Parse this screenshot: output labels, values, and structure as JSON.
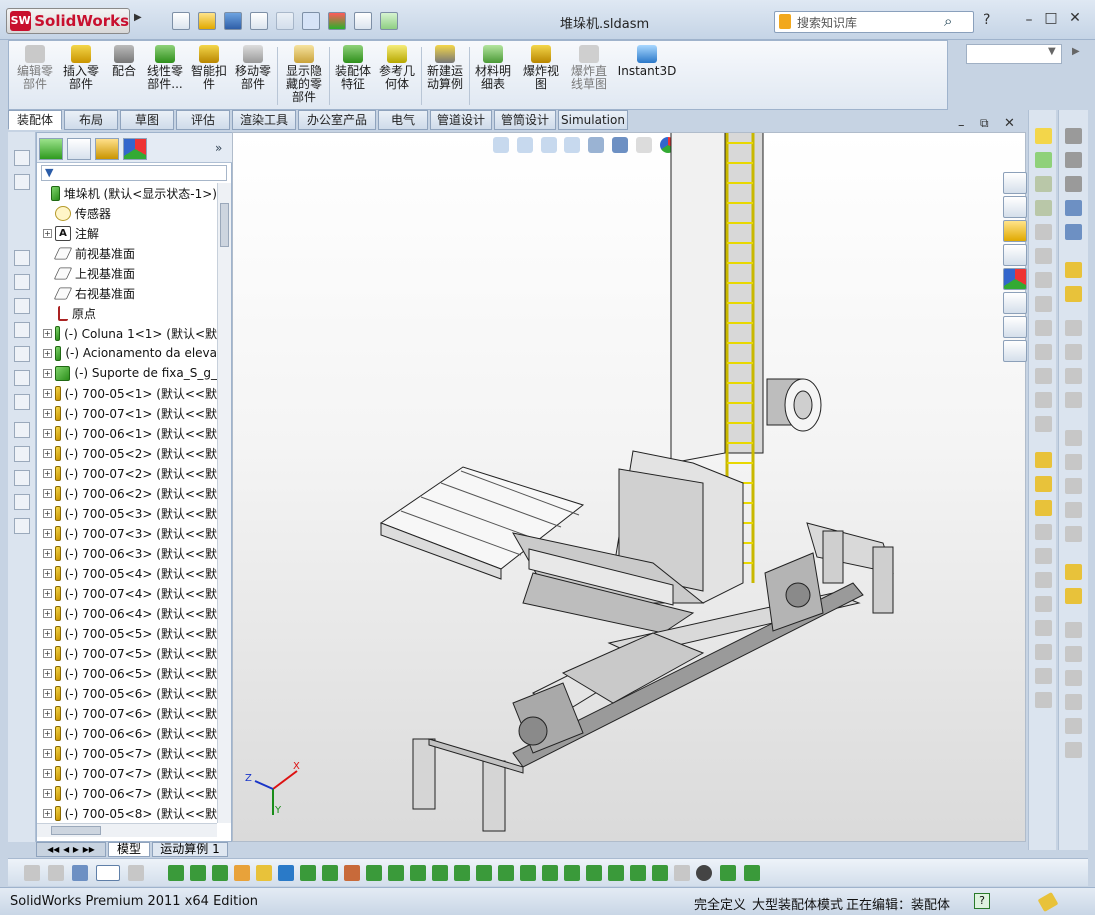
{
  "app": {
    "logo_text": "SolidWorks",
    "document_title": "堆垛机.sldasm"
  },
  "search": {
    "placeholder": "搜索知识库"
  },
  "command_manager": [
    {
      "label": "编辑零\n部件",
      "dim": true
    },
    {
      "label": "插入零\n部件"
    },
    {
      "label": "配合"
    },
    {
      "label": "线性零\n部件..."
    },
    {
      "label": "智能扣\n件"
    },
    {
      "label": "移动零\n部件"
    },
    {
      "label": "显示隐\n藏的零\n部件"
    },
    {
      "label": "装配体\n特征"
    },
    {
      "label": "参考几\n何体"
    },
    {
      "label": "新建运\n动算例"
    },
    {
      "label": "材料明\n细表"
    },
    {
      "label": "爆炸视\n图"
    },
    {
      "label": "爆炸直\n线草图",
      "dim": true
    },
    {
      "label": "Instant3D"
    }
  ],
  "tabs": [
    "装配体",
    "布局",
    "草图",
    "评估",
    "渲染工具",
    "办公室产品",
    "电气",
    "管道设计",
    "管筒设计",
    "Simulation"
  ],
  "tree": [
    {
      "exp": "none",
      "icon": "asm",
      "text": "堆垛机  (默认<显示状态-1>)",
      "indent": 0
    },
    {
      "exp": "none",
      "icon": "sensor",
      "text": "传感器",
      "indent": 1
    },
    {
      "exp": "+",
      "icon": "note",
      "text": "注解",
      "indent": 1
    },
    {
      "exp": "none",
      "icon": "plane",
      "text": "前视基准面",
      "indent": 1
    },
    {
      "exp": "none",
      "icon": "plane",
      "text": "上视基准面",
      "indent": 1
    },
    {
      "exp": "none",
      "icon": "plane",
      "text": "右视基准面",
      "indent": 1
    },
    {
      "exp": "none",
      "icon": "origin",
      "text": "原点",
      "indent": 1
    },
    {
      "exp": "+",
      "icon": "asm",
      "text": "(-) Coluna 1<1> (默认<默",
      "indent": 1
    },
    {
      "exp": "+",
      "icon": "asm",
      "text": "(-) Acionamento da eleva",
      "indent": 1
    },
    {
      "exp": "+",
      "icon": "asm",
      "text": "(-) Suporte de fixa_S_g_",
      "indent": 1
    },
    {
      "exp": "+",
      "icon": "part",
      "text": "(-) 700-05<1> (默认<<默",
      "indent": 1
    },
    {
      "exp": "+",
      "icon": "part",
      "text": "(-) 700-07<1> (默认<<默",
      "indent": 1
    },
    {
      "exp": "+",
      "icon": "part",
      "text": "(-) 700-06<1> (默认<<默",
      "indent": 1
    },
    {
      "exp": "+",
      "icon": "part",
      "text": "(-) 700-05<2> (默认<<默",
      "indent": 1
    },
    {
      "exp": "+",
      "icon": "part",
      "text": "(-) 700-07<2> (默认<<默",
      "indent": 1
    },
    {
      "exp": "+",
      "icon": "part",
      "text": "(-) 700-06<2> (默认<<默",
      "indent": 1
    },
    {
      "exp": "+",
      "icon": "part",
      "text": "(-) 700-05<3> (默认<<默",
      "indent": 1
    },
    {
      "exp": "+",
      "icon": "part",
      "text": "(-) 700-07<3> (默认<<默",
      "indent": 1
    },
    {
      "exp": "+",
      "icon": "part",
      "text": "(-) 700-06<3> (默认<<默",
      "indent": 1
    },
    {
      "exp": "+",
      "icon": "part",
      "text": "(-) 700-05<4> (默认<<默",
      "indent": 1
    },
    {
      "exp": "+",
      "icon": "part",
      "text": "(-) 700-07<4> (默认<<默",
      "indent": 1
    },
    {
      "exp": "+",
      "icon": "part",
      "text": "(-) 700-06<4> (默认<<默",
      "indent": 1
    },
    {
      "exp": "+",
      "icon": "part",
      "text": "(-) 700-05<5> (默认<<默",
      "indent": 1
    },
    {
      "exp": "+",
      "icon": "part",
      "text": "(-) 700-07<5> (默认<<默",
      "indent": 1
    },
    {
      "exp": "+",
      "icon": "part",
      "text": "(-) 700-06<5> (默认<<默",
      "indent": 1
    },
    {
      "exp": "+",
      "icon": "part",
      "text": "(-) 700-05<6> (默认<<默",
      "indent": 1
    },
    {
      "exp": "+",
      "icon": "part",
      "text": "(-) 700-07<6> (默认<<默",
      "indent": 1
    },
    {
      "exp": "+",
      "icon": "part",
      "text": "(-) 700-06<6> (默认<<默",
      "indent": 1
    },
    {
      "exp": "+",
      "icon": "part",
      "text": "(-) 700-05<7> (默认<<默",
      "indent": 1
    },
    {
      "exp": "+",
      "icon": "part",
      "text": "(-) 700-07<7> (默认<<默",
      "indent": 1
    },
    {
      "exp": "+",
      "icon": "part",
      "text": "(-) 700-06<7> (默认<<默",
      "indent": 1
    },
    {
      "exp": "+",
      "icon": "part",
      "text": "(-) 700-05<8> (默认<<默",
      "indent": 1
    }
  ],
  "bottom_tabs": [
    "模型",
    "运动算例 1"
  ],
  "axes": {
    "x": "X",
    "y": "Y",
    "z": "Z"
  },
  "status": {
    "product": "SolidWorks Premium 2011 x64 Edition",
    "defined": "完全定义",
    "mode": "大型装配体模式",
    "editing": "正在编辑：装配体",
    "help": "?"
  },
  "colors": {
    "accent": "#c8102e",
    "viewport_top": "#ffffff",
    "viewport_bottom": "#dadada",
    "rail_yellow": "#f2e600"
  }
}
